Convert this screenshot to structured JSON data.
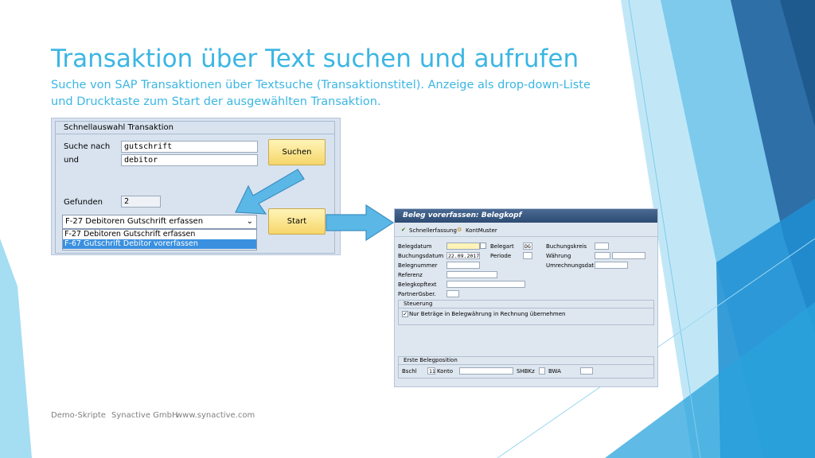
{
  "slide": {
    "title": "Transaktion über Text suchen und aufrufen",
    "subtitle": "Suche von SAP Transaktionen über Textsuche (Transaktionstitel). Anzeige als drop-down-Liste und Drucktaste zum Start der ausgewählten Transaktion.",
    "footer": {
      "left": "Demo-Skripte",
      "middle": "Synactive GmbH",
      "right": "www.synactive.com"
    }
  },
  "colors": {
    "title": "#3bb6e3",
    "deco_blue": "#2f89c9",
    "deco_dark": "#1f6aa8",
    "deco_light": "#8ed4f0"
  },
  "quick_select": {
    "header": "Schnellauswahl Transaktion",
    "search_label": "Suche nach",
    "search_value": "gutschrift",
    "and_label": "und",
    "and_value": "debitor",
    "found_label": "Gefunden",
    "found_value": "2",
    "search_button": "Suchen",
    "start_button": "Start",
    "dropdown_selected": "F-27 Debitoren Gutschrift erfassen",
    "dropdown_options": [
      "F-27 Debitoren Gutschrift erfassen",
      "F-67 Gutschrift Debitor vorerfassen"
    ]
  },
  "doc_entry": {
    "title": "Beleg vorerfassen: Belegkopf",
    "toolbar": {
      "fast_entry": "Schnellerfassung",
      "account_model": "KontMuster"
    },
    "fields": {
      "doc_date": "Belegdatum",
      "doc_type": "Belegart",
      "doc_type_value": "DG",
      "company_code": "Buchungskreis",
      "posting_date": "Buchungsdatum",
      "posting_date_value": "22.09.2017",
      "period": "Periode",
      "currency": "Währung",
      "doc_number": "Belegnummer",
      "conversion_date": "Umrechnungsdat",
      "reference": "Referenz",
      "header_text": "Belegkopftext",
      "partner": "PartnerGsber."
    },
    "control": {
      "header": "Steuerung",
      "checkbox_label": "Nur Beträge in Belegwährung in Rechnung übernehmen"
    },
    "first_item": {
      "header": "Erste Belegposition",
      "posting_key": "Bschl",
      "posting_key_value": "11",
      "account": "Konto",
      "sgl": "SHBKz",
      "transaction_type": "BWA"
    }
  }
}
